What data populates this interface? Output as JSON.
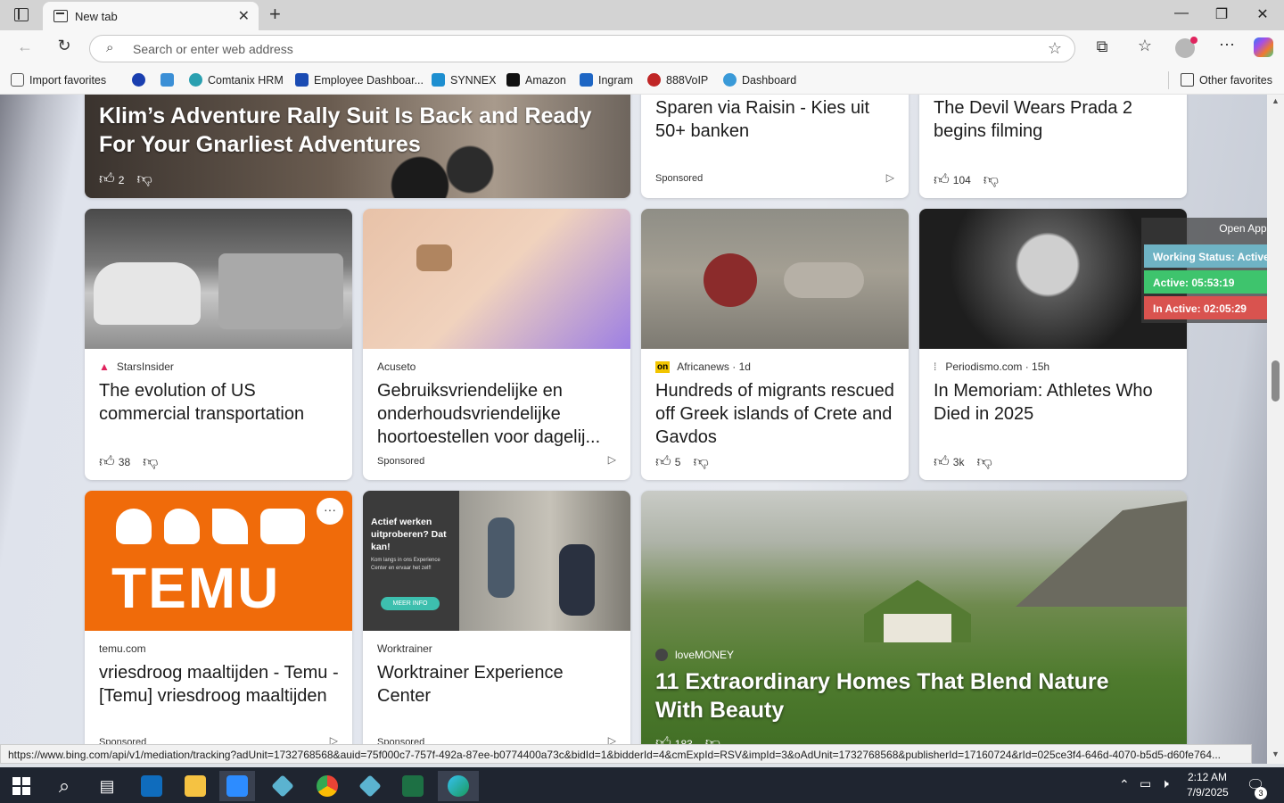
{
  "browser": {
    "tab_title": "New tab",
    "address_placeholder": "Search or enter web address"
  },
  "bookmarks": {
    "items": [
      {
        "label": "Import favorites",
        "color": "#555555"
      },
      {
        "label": "",
        "color": "#1a3fb0"
      },
      {
        "label": "",
        "color": "#3b8fd6"
      },
      {
        "label": "Comtanix HRM",
        "color": "#2aa0b0"
      },
      {
        "label": "Employee Dashboar...",
        "color": "#1a4bb3"
      },
      {
        "label": "SYNNEX",
        "color": "#1e8fd0"
      },
      {
        "label": "Amazon",
        "color": "#111111"
      },
      {
        "label": "Ingram",
        "color": "#1e66c4"
      },
      {
        "label": "888VoIP",
        "color": "#c02626"
      },
      {
        "label": "Dashboard",
        "color": "#3a9ad8"
      }
    ],
    "other": "Other favorites"
  },
  "feed": {
    "hero": {
      "title": "Klim’s Adventure Rally Suit Is Back and Ready For Your Gnarliest Adventures",
      "likes": "2"
    },
    "top2": {
      "title": "Sparen via Raisin - Kies uit 50+ banken",
      "sponsored": "Sponsored"
    },
    "top3": {
      "title": "The Devil Wears Prada 2 begins filming",
      "likes": "104"
    },
    "row2": [
      {
        "source": "StarsInsider",
        "meta": "",
        "title": "The evolution of US commercial transportation",
        "likes": "38",
        "sponsored": ""
      },
      {
        "source": "Acuseto",
        "meta": "",
        "title": "Gebruiksvriendelijke en onderhoudsvriendelijke hoortoestellen voor dagelij...",
        "likes": "",
        "sponsored": "Sponsored"
      },
      {
        "source": "Africanews",
        "meta": "· 1d",
        "title": "Hundreds of migrants rescued off Greek islands of Crete and Gavdos",
        "likes": "5",
        "sponsored": ""
      },
      {
        "source": "Periodismo.com",
        "meta": "· 15h",
        "title": "In Memoriam: Athletes Who Died in 2025",
        "likes": "3k",
        "sponsored": ""
      }
    ],
    "row3": {
      "temu": {
        "source": "temu.com",
        "title": "vriesdroog maaltijden - Temu - [Temu] vriesdroog maaltijden",
        "sponsored": "Sponsored",
        "logo": "TEMU"
      },
      "worktrainer": {
        "source": "Worktrainer",
        "title": "Worktrainer Experience Center",
        "sponsored": "Sponsored",
        "ad_heading": "Actief werken uitproberen? Dat kan!",
        "ad_sub": "Kom langs in ons Experience Center en ervaar het zelf!",
        "ad_button": "MEER INFO"
      },
      "big": {
        "source": "loveMONEY",
        "title": "11 Extraordinary Homes That Blend Nature With Beauty",
        "likes": "183"
      }
    }
  },
  "widget": {
    "open_app": "Open App ↗",
    "status": "Working Status: Active",
    "active": "Active: 05:53:19",
    "inactive": "In Active: 02:05:29",
    "colors": {
      "status": "#6fb3c4",
      "active": "#3ec46d",
      "inactive": "#d9534f"
    }
  },
  "status_url": "https://www.bing.com/api/v1/mediation/tracking?adUnit=1732768568&auid=75f000c7-757f-492a-87ee-b0774400a73c&bidId=1&bidderId=4&cmExpId=RSV&impId=3&oAdUnit=1732768568&publisherId=17160724&rId=025ce3f4-646d-4070-b5d5-d60fe764...",
  "taskbar": {
    "apps": [
      "windows-start",
      "search",
      "task-view",
      "outlook",
      "file-explorer",
      "zoom",
      "app-diamond",
      "chrome",
      "app-diamond-2",
      "excel",
      "edge"
    ],
    "time": "2:12 AM",
    "date": "7/9/2025",
    "notifications": "3"
  }
}
